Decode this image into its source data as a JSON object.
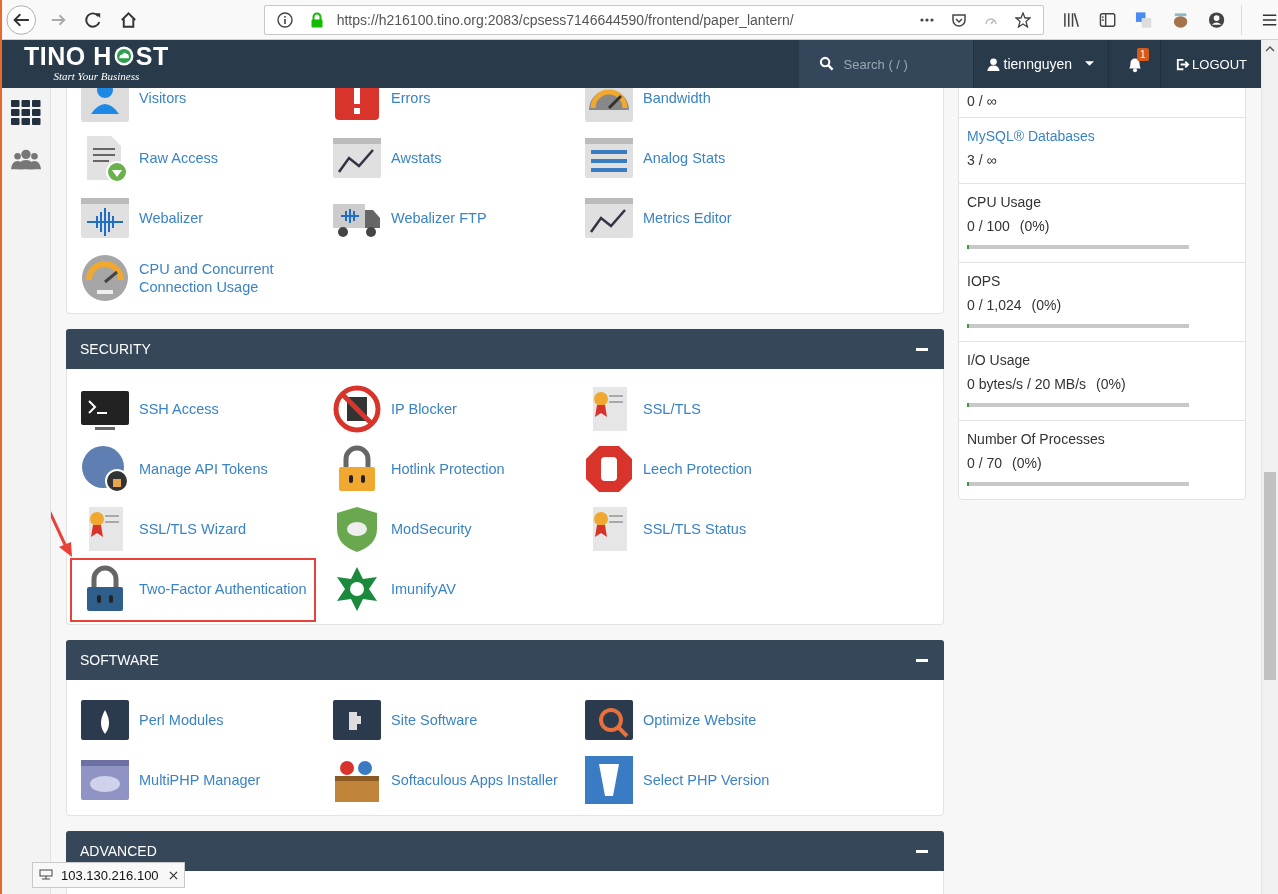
{
  "browser": {
    "url": "https://h216100.tino.org:2083/cpsess7146644590/frontend/paper_lantern/"
  },
  "header": {
    "logo_left": "TINO H",
    "logo_right": "ST",
    "tagline": "Start Your Business",
    "search_placeholder": "Search ( / )",
    "user": "tiennguyen",
    "notification_count": "1",
    "logout": "LOGOUT"
  },
  "sections": [
    {
      "items": [
        {
          "label": "Visitors",
          "highlighted": false
        },
        {
          "label": "Errors",
          "highlighted": false
        },
        {
          "label": "Bandwidth",
          "highlighted": false
        },
        {
          "label": "Raw Access",
          "highlighted": false
        },
        {
          "label": "Awstats",
          "highlighted": false
        },
        {
          "label": "Analog Stats",
          "highlighted": false
        },
        {
          "label": "Webalizer",
          "highlighted": false
        },
        {
          "label": "Webalizer FTP",
          "highlighted": false
        },
        {
          "label": "Metrics Editor",
          "highlighted": false
        },
        {
          "label": "CPU and Concurrent Connection Usage",
          "highlighted": false
        }
      ]
    },
    {
      "title": "SECURITY",
      "expanded": true,
      "items": [
        {
          "label": "SSH Access",
          "highlighted": false
        },
        {
          "label": "IP Blocker",
          "highlighted": false
        },
        {
          "label": "SSL/TLS",
          "highlighted": false
        },
        {
          "label": "Manage API Tokens",
          "highlighted": false
        },
        {
          "label": "Hotlink Protection",
          "highlighted": false
        },
        {
          "label": "Leech Protection",
          "highlighted": false
        },
        {
          "label": "SSL/TLS Wizard",
          "highlighted": false
        },
        {
          "label": "ModSecurity",
          "highlighted": false
        },
        {
          "label": "SSL/TLS Status",
          "highlighted": false
        },
        {
          "label": "Two-Factor Authentication",
          "highlighted": true
        },
        {
          "label": "ImunifyAV",
          "highlighted": false
        }
      ]
    },
    {
      "title": "SOFTWARE",
      "expanded": true,
      "items": [
        {
          "label": "Perl Modules",
          "highlighted": false
        },
        {
          "label": "Site Software",
          "highlighted": false
        },
        {
          "label": "Optimize Website",
          "highlighted": false
        },
        {
          "label": "MultiPHP Manager",
          "highlighted": false
        },
        {
          "label": "Softaculous Apps Installer",
          "highlighted": false
        },
        {
          "label": "Select PHP Version",
          "highlighted": false
        }
      ]
    },
    {
      "title": "ADVANCED",
      "expanded": true
    }
  ],
  "stats": [
    {
      "kind": "count",
      "value": "0 / ∞"
    },
    {
      "kind": "count",
      "label": "MySQL® Databases",
      "value": "3 / ∞"
    },
    {
      "kind": "meter",
      "label": "CPU Usage",
      "value": "0 / 100",
      "percent": "(0%)",
      "level": 0
    },
    {
      "kind": "meter",
      "label": "IOPS",
      "value": "0 / 1,024",
      "percent": "(0%)",
      "level": 0
    },
    {
      "kind": "meter",
      "label": "I/O Usage",
      "value": "0 bytes/s / 20 MB/s",
      "percent": "(0%)",
      "level": 0
    },
    {
      "kind": "meter",
      "label": "Number Of Processes",
      "value": "0 / 70",
      "percent": "(0%)",
      "level": 0
    }
  ],
  "tooltip": {
    "text": "103.130.216.100"
  }
}
